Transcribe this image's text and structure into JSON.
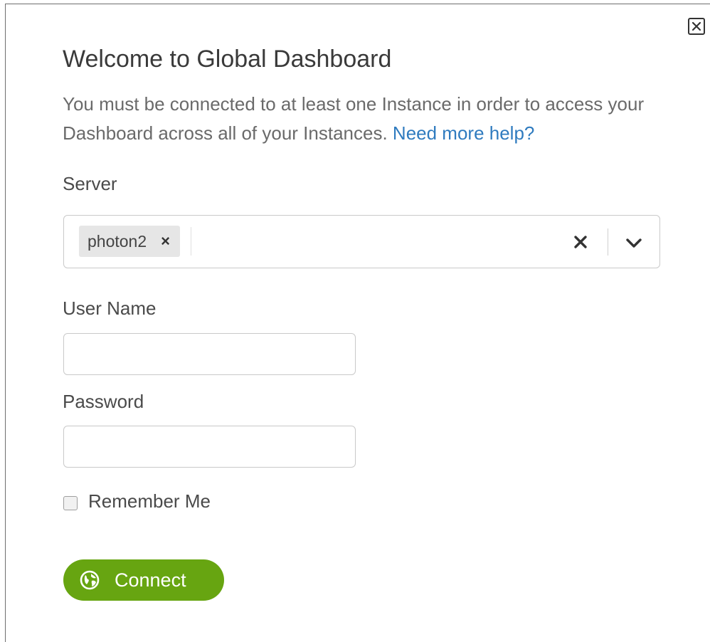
{
  "dialog": {
    "title": "Welcome to Global Dashboard",
    "intro_text": "You must be connected to at least one Instance in order to access your Dashboard across all of your Instances.",
    "help_link": "Need more help?"
  },
  "server": {
    "label": "Server",
    "selected": [
      "photon2"
    ]
  },
  "username": {
    "label": "User Name",
    "value": "",
    "placeholder": ""
  },
  "password": {
    "label": "Password",
    "value": "",
    "placeholder": ""
  },
  "remember": {
    "label": "Remember Me",
    "checked": false
  },
  "connect": {
    "label": "Connect"
  },
  "colors": {
    "accent": "#67a511",
    "link": "#2f7bbf",
    "chip_bg": "#e6e6e6",
    "border": "#c9c9c9"
  },
  "icons": {
    "close": "close-icon",
    "chip_remove": "remove-icon",
    "clear": "clear-icon",
    "dropdown": "chevron-down-icon",
    "connect": "globe-icon"
  }
}
